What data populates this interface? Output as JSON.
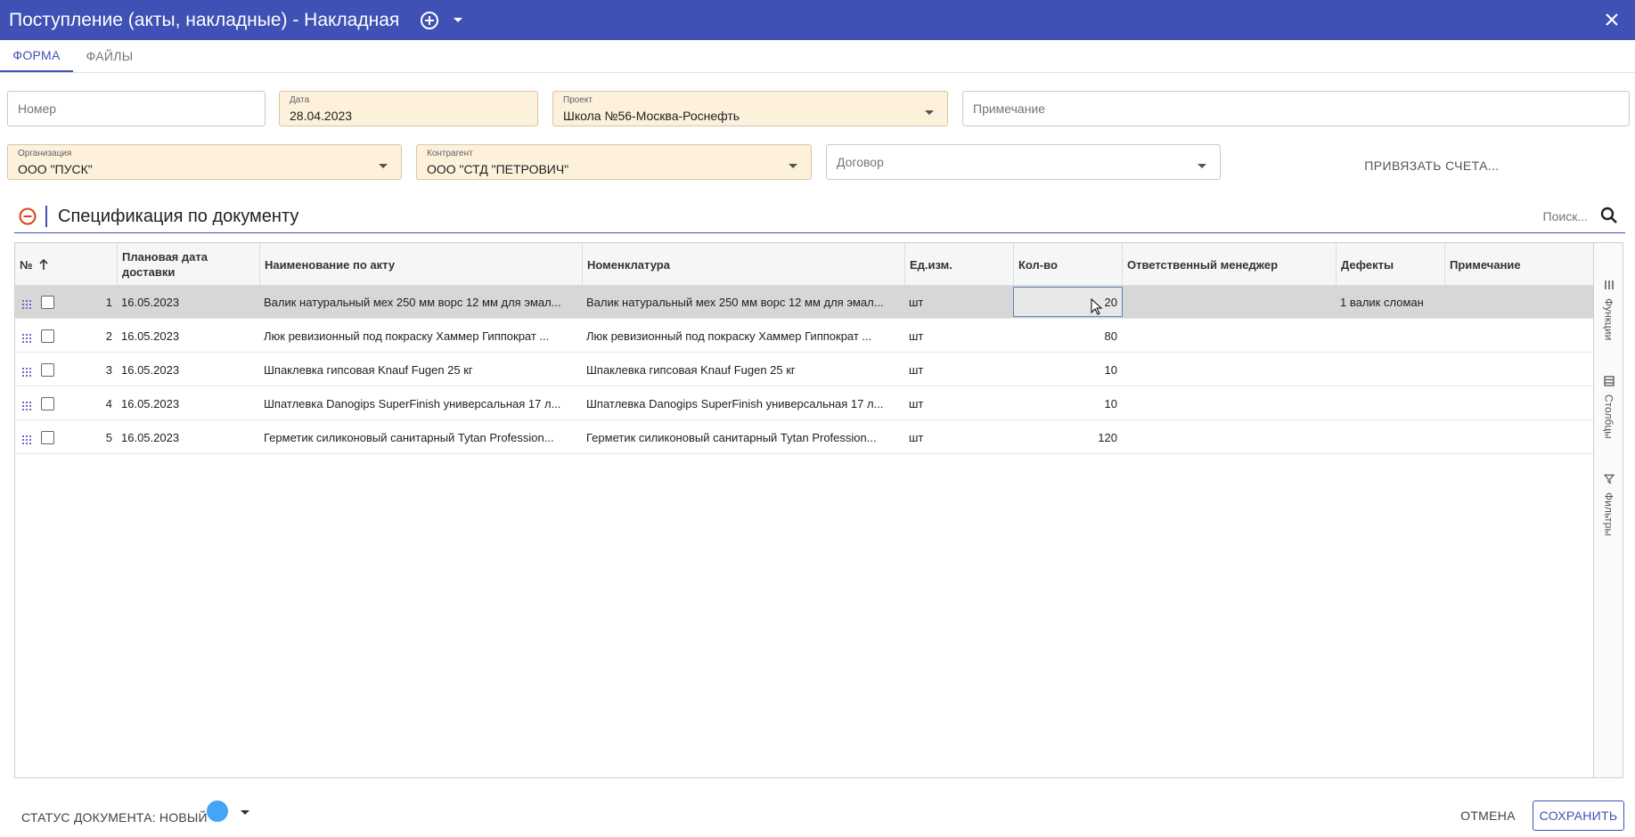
{
  "window": {
    "title": "Поступление (акты, накладные) - Накладная",
    "accent_color": "#3f51b5"
  },
  "tabs": [
    {
      "label": "ФОРМА",
      "active": true
    },
    {
      "label": "ФАЙЛЫ",
      "active": false
    }
  ],
  "form": {
    "number": {
      "placeholder": "Номер",
      "value": ""
    },
    "date": {
      "label": "Дата",
      "value": "28.04.2023"
    },
    "project": {
      "label": "Проект",
      "value": "Школа №56-Москва-Роснефть"
    },
    "note": {
      "placeholder": "Примечание",
      "value": ""
    },
    "organization": {
      "label": "Организация",
      "value": "ООО \"ПУСК\""
    },
    "counterparty": {
      "label": "Контрагент",
      "value": "ООО \"СТД \"ПЕТРОВИЧ\""
    },
    "contract": {
      "placeholder": "Договор",
      "value": ""
    },
    "link_invoices_label": "ПРИВЯЗАТЬ СЧЕТА..."
  },
  "spec": {
    "title": "Спецификация по документу",
    "search_placeholder": "Поиск...",
    "columns": [
      {
        "label": "№"
      },
      {
        "label": "Плановая дата доставки"
      },
      {
        "label": "Наименование по акту"
      },
      {
        "label": "Номенклатура"
      },
      {
        "label": "Ед.изм."
      },
      {
        "label": "Кол-во"
      },
      {
        "label": "Ответственный менеджер"
      },
      {
        "label": "Дефекты"
      },
      {
        "label": "Примечание"
      }
    ],
    "rows": [
      {
        "num": "1",
        "date": "16.05.2023",
        "act_name": "Валик натуральный мех 250 мм ворс 12 мм для эмал...",
        "nomenclature": "Валик натуральный мех 250 мм ворс 12 мм для эмал...",
        "unit": "шт",
        "qty": "20",
        "manager": "",
        "defects": "1 валик сломан",
        "note": "",
        "selected": true
      },
      {
        "num": "2",
        "date": "16.05.2023",
        "act_name": "Люк ревизионный под покраску Хаммер Гиппократ ...",
        "nomenclature": "Люк ревизионный под покраску Хаммер Гиппократ ...",
        "unit": "шт",
        "qty": "80",
        "manager": "",
        "defects": "",
        "note": "",
        "selected": false
      },
      {
        "num": "3",
        "date": "16.05.2023",
        "act_name": "Шпаклевка гипсовая Knauf Fugen 25 кг",
        "nomenclature": "Шпаклевка гипсовая Knauf Fugen 25 кг",
        "unit": "шт",
        "qty": "10",
        "manager": "",
        "defects": "",
        "note": "",
        "selected": false
      },
      {
        "num": "4",
        "date": "16.05.2023",
        "act_name": "Шпатлевка Danogips SuperFinish универсальная 17 л...",
        "nomenclature": "Шпатлевка Danogips SuperFinish универсальная 17 л...",
        "unit": "шт",
        "qty": "10",
        "manager": "",
        "defects": "",
        "note": "",
        "selected": false
      },
      {
        "num": "5",
        "date": "16.05.2023",
        "act_name": "Герметик силиконовый санитарный Tytan Profession...",
        "nomenclature": "Герметик силиконовый санитарный Tytan Profession...",
        "unit": "шт",
        "qty": "120",
        "manager": "",
        "defects": "",
        "note": "",
        "selected": false
      }
    ],
    "side_tabs": [
      {
        "label": "Функции",
        "icon": "menu-icon"
      },
      {
        "label": "Столбцы",
        "icon": "columns-icon"
      },
      {
        "label": "Фильтры",
        "icon": "filter-icon"
      }
    ]
  },
  "footer": {
    "status_label": "СТАТУС ДОКУМЕНТА: НОВЫЙ",
    "status_color": "#42a5f5",
    "cancel_label": "ОТМЕНА",
    "save_label": "СОХРАНИТЬ"
  }
}
